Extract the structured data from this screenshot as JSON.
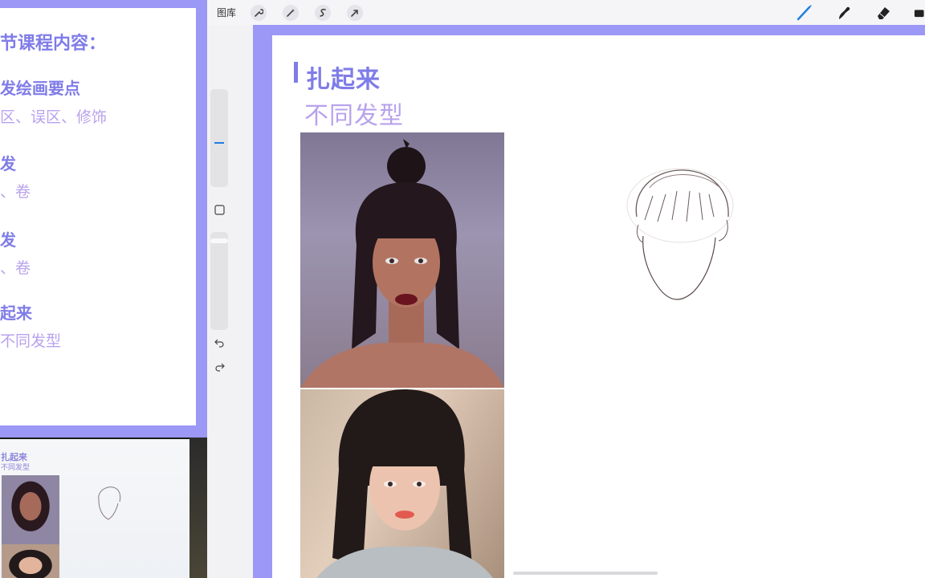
{
  "left_slide": {
    "heading": "节课程内容：",
    "items": [
      {
        "title": "发绘画要点",
        "detail": "区、误区、修饰"
      },
      {
        "title": "发",
        "detail": "、卷"
      },
      {
        "title": "发",
        "detail": "、卷"
      },
      {
        "title": "起来",
        "detail": "不同发型"
      }
    ]
  },
  "webcam_preview": {
    "title": "扎起来",
    "subtitle": "不同发型"
  },
  "topbar": {
    "gallery": "图库",
    "actions_icon": "wrench-icon",
    "adjustments_icon": "magic-wand-icon",
    "selection_icon": "s-select-icon",
    "transform_icon": "arrow-cursor-icon",
    "brush_icon": "brush-icon",
    "smudge_icon": "smudge-icon",
    "eraser_icon": "eraser-icon",
    "layers_icon": "layers-icon",
    "accent_color": "#1f7fe0"
  },
  "sidebar": {
    "modify_icon": "square-icon",
    "undo_icon": "undo-icon",
    "redo_icon": "redo-icon"
  },
  "canvas": {
    "title": "扎起来",
    "subtitle": "不同发型",
    "title_color": "#7f7ce8",
    "subtitle_color": "#b8a2ec",
    "frame_color": "#9c98f5"
  }
}
